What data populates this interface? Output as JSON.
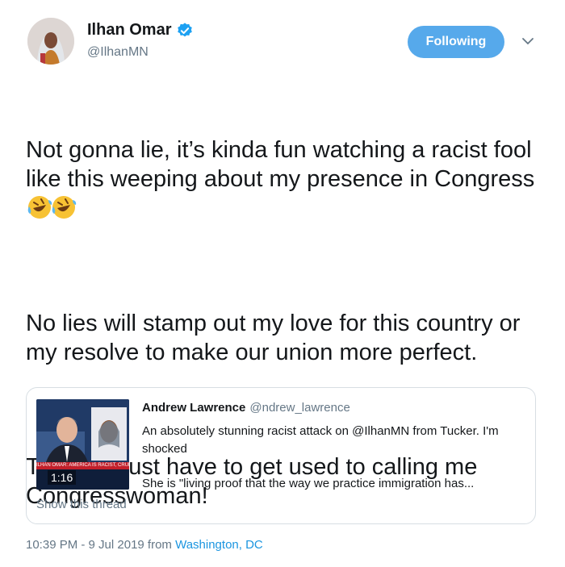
{
  "author": {
    "display_name": "Ilhan Omar",
    "handle": "@IlhanMN",
    "verified": true,
    "avatar_icon": "profile-photo"
  },
  "follow_button": {
    "label": "Following",
    "color": "#56a9eb"
  },
  "menu_icon": "chevron-down-icon",
  "tweet": {
    "line1": "Not gonna lie, it’s kinda fun watching a racist fool like this weeping about my presence in Congress ",
    "emoji": "rolling-on-floor-laughing",
    "line2": "No lies will stamp out my love for this country or my resolve to make our union more perfect.",
    "line3": "They will just have to get used to calling me Congresswoman!"
  },
  "quoted_tweet": {
    "author_name": "Andrew Lawrence",
    "author_handle": "@ndrew_lawrence",
    "text_1": "An absolutely stunning racist attack on @IlhanMN from Tucker. I'm shocked",
    "text_2": "She is \"living proof that the way we practice immigration has...",
    "video_duration": "1:16",
    "video_chyron": "ILHAN OMAR: AMERICA IS RACIST, CRUEL & UNA",
    "show_thread": "Show this thread"
  },
  "meta": {
    "timestamp": "10:39 PM - 9 Jul 2019 from ",
    "location": "Washington, DC"
  },
  "colors": {
    "link": "#1b95e0",
    "secondary": "#657786",
    "verified": "#1da1f2"
  }
}
